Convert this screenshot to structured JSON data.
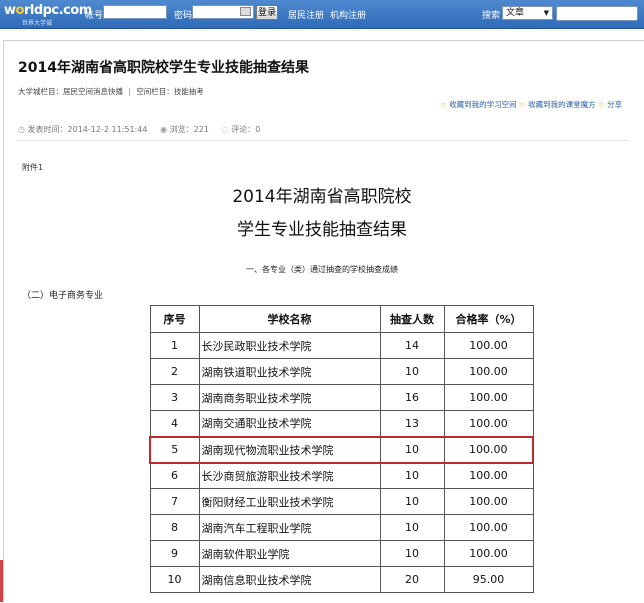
{
  "topbar": {
    "logo_main_a": "w",
    "logo_main_accent": "o",
    "logo_main_b": "rldpc.com",
    "logo_sub": "世界大学城",
    "account_label": "帐号",
    "password_label": "密码",
    "login_button": "登录",
    "links": [
      "居民注册",
      "机构注册"
    ],
    "search_label": "搜索",
    "search_type": "文章",
    "brand_color": "#2f6ab8"
  },
  "article": {
    "title": "2014年湖南省高职院校学生专业技能抽查结果",
    "crumbs": [
      {
        "label": "大学城栏目：",
        "value": "居民空间消息快播"
      },
      {
        "label": "空间栏目：",
        "value": "技能抽考"
      }
    ],
    "actions": [
      "收藏到我的学习空间",
      "收藏到我的课堂魔方",
      "分享"
    ],
    "meta": {
      "published_label": "发表时间：",
      "published": "2014-12-2 11:51:44",
      "views_label": "浏览：",
      "views": "221",
      "comments_label": "评论：",
      "comments": "0"
    }
  },
  "document": {
    "attachment": "附件1",
    "title_line1": "2014年湖南省高职院校",
    "title_line2": "学生专业技能抽查结果",
    "subheading": "一、各专业（类）通过抽查的学校抽查成绩",
    "section": "（二）电子商务专业",
    "table": {
      "headers": [
        "序号",
        "学校名称",
        "抽查人数",
        "合格率（%）"
      ],
      "highlighted_row": 5,
      "highlight_color": "#c0282d",
      "rows": [
        {
          "no": "1",
          "school": "长沙民政职业技术学院",
          "count": "14",
          "rate": "100.00"
        },
        {
          "no": "2",
          "school": "湖南铁道职业技术学院",
          "count": "10",
          "rate": "100.00"
        },
        {
          "no": "3",
          "school": "湖南商务职业技术学院",
          "count": "16",
          "rate": "100.00"
        },
        {
          "no": "4",
          "school": "湖南交通职业技术学院",
          "count": "13",
          "rate": "100.00"
        },
        {
          "no": "5",
          "school": "湖南现代物流职业技术学院",
          "count": "10",
          "rate": "100.00"
        },
        {
          "no": "6",
          "school": "长沙商贸旅游职业技术学院",
          "count": "10",
          "rate": "100.00"
        },
        {
          "no": "7",
          "school": "衡阳财经工业职业技术学院",
          "count": "10",
          "rate": "100.00"
        },
        {
          "no": "8",
          "school": "湖南汽车工程职业学院",
          "count": "10",
          "rate": "100.00"
        },
        {
          "no": "9",
          "school": "湖南软件职业学院",
          "count": "10",
          "rate": "100.00"
        },
        {
          "no": "10",
          "school": "湖南信息职业技术学院",
          "count": "20",
          "rate": "95.00"
        }
      ]
    }
  }
}
